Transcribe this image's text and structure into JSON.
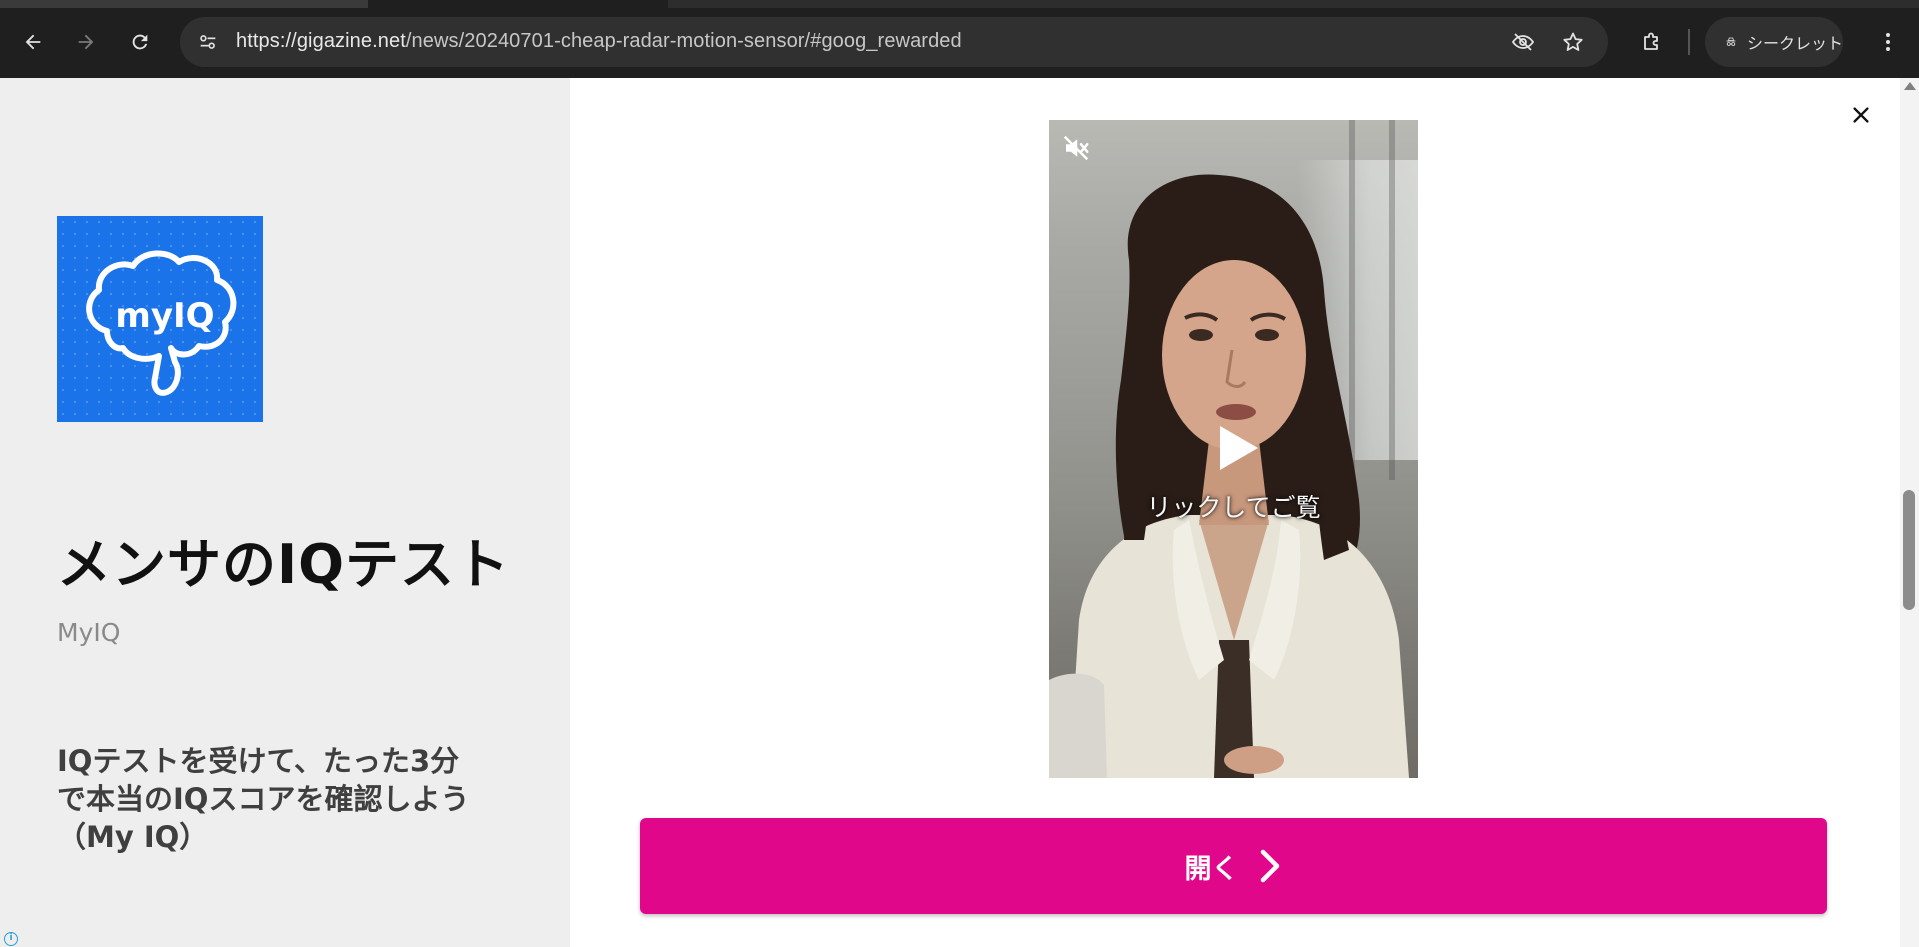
{
  "browser": {
    "url_host": "https://gigazine.net",
    "url_path": "/news/20240701-cheap-radar-motion-sensor/#goog_rewarded",
    "incognito_label": "シークレット",
    "icons": [
      "back-icon",
      "forward-icon",
      "reload-icon",
      "site-info-icon",
      "eye-off-icon",
      "star-icon",
      "extensions-icon",
      "incognito-icon",
      "kebab-menu-icon"
    ]
  },
  "ad": {
    "logo_text": "myIQ",
    "app_title": "メンサのIQテスト",
    "developer": "MyIQ",
    "description": "IQテストを受けて、たった3分で本当のIQスコアを確認しよう（My IQ）",
    "video_caption": "リックしてご覧",
    "open_button_label": "開く",
    "colors": {
      "logo_bg": "#1a73e8",
      "button_bg": "#e0078a",
      "left_panel_bg": "#eeeeee"
    }
  }
}
